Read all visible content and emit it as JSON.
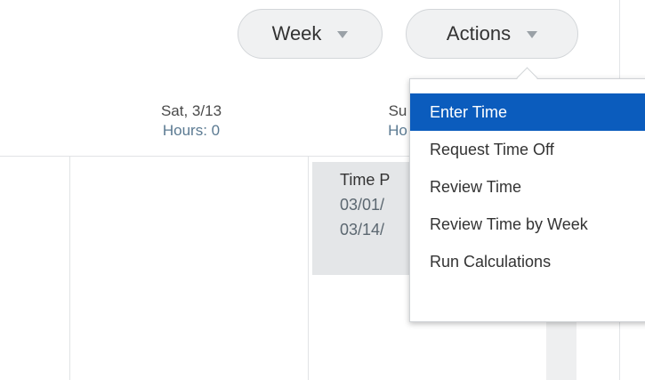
{
  "toolbar": {
    "week_label": "Week",
    "actions_label": "Actions"
  },
  "days": [
    {
      "date": "Sat, 3/13",
      "hours": "Hours: 0"
    },
    {
      "date": "Su",
      "hours": "Ho"
    }
  ],
  "time_block": {
    "title": "Time P",
    "line1": "03/01/",
    "line2": "03/14/"
  },
  "actions_menu": {
    "items": [
      {
        "label": "Enter Time",
        "active": true
      },
      {
        "label": "Request Time Off",
        "active": false
      },
      {
        "label": "Review Time",
        "active": false
      },
      {
        "label": "Review Time by Week",
        "active": false
      },
      {
        "label": "Run Calculations",
        "active": false
      }
    ]
  },
  "colors": {
    "menu_highlight": "#0b5cbd",
    "pill_bg": "#f0f1f2",
    "time_block_bg": "#e4e6e8",
    "hours_text": "#5b7a92"
  },
  "icons": {
    "week_caret": "caret-down-icon",
    "actions_caret": "caret-down-icon"
  }
}
